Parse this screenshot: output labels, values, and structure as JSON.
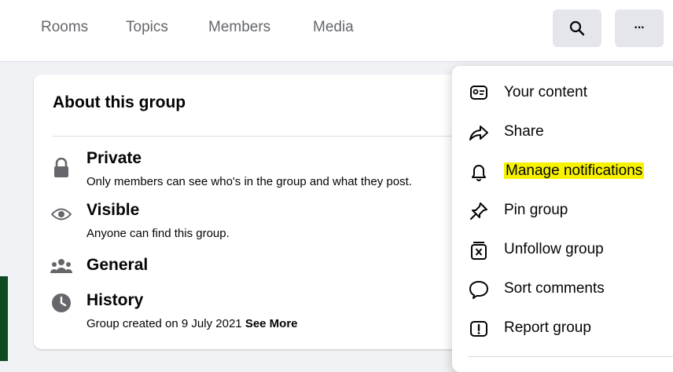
{
  "nav": {
    "tabs": [
      {
        "label": "Rooms"
      },
      {
        "label": "Topics"
      },
      {
        "label": "Members"
      },
      {
        "label": "Media"
      }
    ],
    "search_icon": "search-icon",
    "more_label": "···"
  },
  "about": {
    "title": "About this group",
    "items": [
      {
        "icon": "lock-icon",
        "title": "Private",
        "subtitle": "Only members can see who's in the group and what they post."
      },
      {
        "icon": "eye-icon",
        "title": "Visible",
        "subtitle": "Anyone can find this group."
      },
      {
        "icon": "people-icon",
        "title": "General",
        "subtitle": ""
      },
      {
        "icon": "clock-icon",
        "title": "History",
        "subtitle": "Group created on 9 July 2021"
      }
    ],
    "see_more": "See More"
  },
  "menu": {
    "items": [
      {
        "icon": "content-card-icon",
        "label": "Your content"
      },
      {
        "icon": "share-icon",
        "label": "Share"
      },
      {
        "icon": "bell-icon",
        "label": "Manage notifications",
        "highlighted": true
      },
      {
        "icon": "pin-icon",
        "label": "Pin group"
      },
      {
        "icon": "unfollow-icon",
        "label": "Unfollow group"
      },
      {
        "icon": "comment-icon",
        "label": "Sort comments"
      },
      {
        "icon": "report-icon",
        "label": "Report group"
      }
    ]
  },
  "colors": {
    "highlight": "#f7f200",
    "secondary_text": "#65676b",
    "background": "#f0f2f5"
  }
}
